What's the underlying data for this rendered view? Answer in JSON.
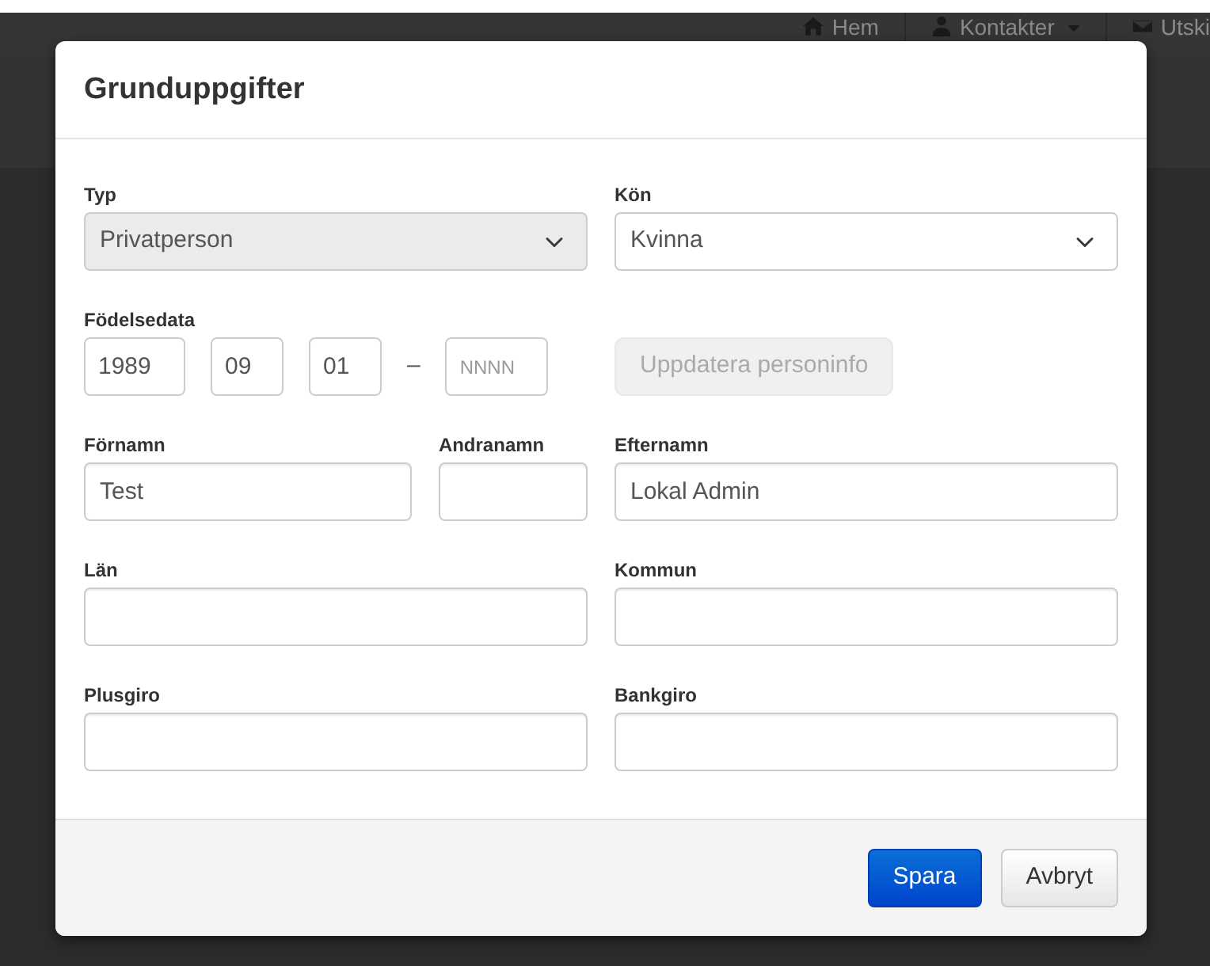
{
  "nav": [
    {
      "label": "Hem",
      "dropdown": false
    },
    {
      "label": "Kontakter",
      "dropdown": true
    },
    {
      "label": "Utski",
      "dropdown": false
    }
  ],
  "modal": {
    "title": "Grunduppgifter",
    "type_field": {
      "label": "Typ",
      "value": "Privatperson",
      "disabled": true
    },
    "gender_field": {
      "label": "Kön",
      "value": "Kvinna",
      "disabled": false
    },
    "birth_date": {
      "label": "Födelsedata",
      "parts": [
        {
          "value": "1989"
        },
        {
          "value": "09"
        },
        {
          "value": "01"
        },
        {
          "placeholder": "NNNN"
        }
      ],
      "separator": "–"
    },
    "update_button": {
      "label": "Uppdatera personinfo",
      "disabled": true
    },
    "first_name": {
      "label": "Förnamn",
      "value": "Test"
    },
    "middle_name": {
      "label": "Andranamn"
    },
    "last_name": {
      "label": "Efternamn",
      "value": "Lokal Admin"
    },
    "county": {
      "label": "Län"
    },
    "municipality": {
      "label": "Kommun"
    },
    "plusgiro": {
      "label": "Plusgiro"
    },
    "bankgiro": {
      "label": "Bankgiro"
    },
    "buttons": [
      {
        "label": "Spara",
        "kind": "primary"
      },
      {
        "label": "Avbryt",
        "kind": "default"
      }
    ]
  }
}
